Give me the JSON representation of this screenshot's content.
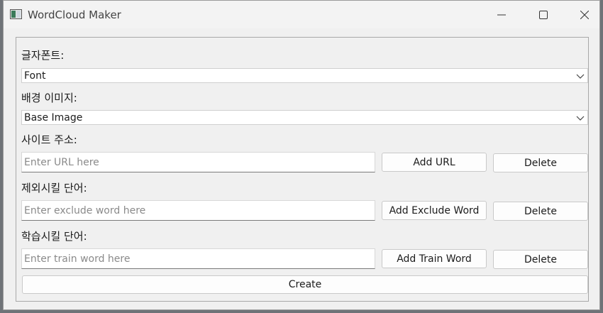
{
  "window": {
    "title": "WordCloud Maker",
    "icons": [
      "app-icon",
      "minimize-icon",
      "maximize-icon",
      "close-icon"
    ]
  },
  "font": {
    "label": "글자폰트:",
    "selected": "Font"
  },
  "background_image": {
    "label": "배경 이미지:",
    "selected": "Base Image"
  },
  "site_url": {
    "label": "사이트 주소:",
    "placeholder": "Enter URL here",
    "value": "",
    "add_label": "Add URL",
    "delete_label": "Delete"
  },
  "exclude_word": {
    "label": "제외시킬 단어:",
    "placeholder": "Enter exclude word here",
    "value": "",
    "add_label": "Add Exclude Word",
    "delete_label": "Delete"
  },
  "train_word": {
    "label": "학습시킬 단어:",
    "placeholder": "Enter train word here",
    "value": "",
    "add_label": "Add Train Word",
    "delete_label": "Delete"
  },
  "create_label": "Create"
}
